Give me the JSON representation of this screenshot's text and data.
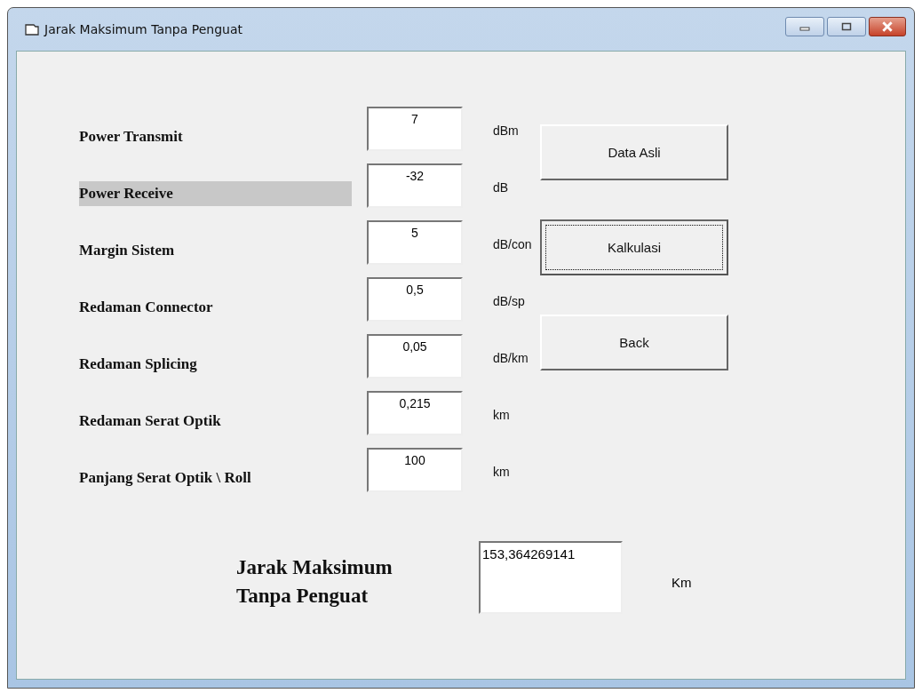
{
  "window": {
    "title": "Jarak Maksimum Tanpa Penguat"
  },
  "fields": [
    {
      "label": "Power Transmit",
      "value": "7",
      "unit": "dBm",
      "highlighted": false
    },
    {
      "label": "Power Receive",
      "value": "-32",
      "unit": "dB",
      "highlighted": true
    },
    {
      "label": "Margin Sistem",
      "value": "5",
      "unit": "dB/con",
      "highlighted": false
    },
    {
      "label": "Redaman Connector",
      "value": "0,5",
      "unit": "dB/sp",
      "highlighted": false
    },
    {
      "label": "Redaman Splicing",
      "value": "0,05",
      "unit": "dB/km",
      "highlighted": false
    },
    {
      "label": "Redaman Serat Optik",
      "value": "0,215",
      "unit": "km",
      "highlighted": false
    },
    {
      "label": "Panjang Serat Optik \\ Roll",
      "value": "100",
      "unit": "km",
      "highlighted": false
    }
  ],
  "buttons": [
    {
      "label": "Data Asli",
      "focused": false
    },
    {
      "label": "Kalkulasi",
      "focused": true
    },
    {
      "label": "Back",
      "focused": false
    }
  ],
  "result": {
    "label_lines": [
      "Jarak Maksimum",
      "Tanpa Penguat"
    ],
    "value": "153,364269141",
    "unit": "Km"
  }
}
